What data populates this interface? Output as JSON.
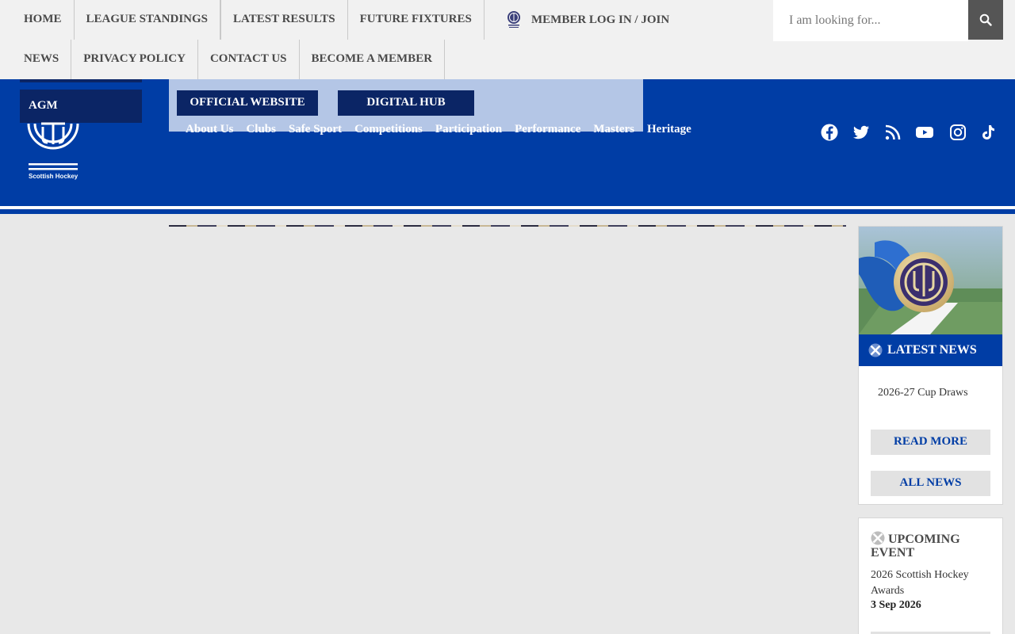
{
  "topnav": {
    "row1": [
      "HOME",
      "LEAGUE STANDINGS",
      "LATEST RESULTS",
      "FUTURE FIXTURES"
    ],
    "row2": [
      "NEWS",
      "PRIVACY POLICY",
      "CONTACT US",
      "BECOME A MEMBER"
    ],
    "member_label": "MEMBER LOG IN / JOIN",
    "search_placeholder": "I am looking for..."
  },
  "header": {
    "agm_label": "AGM",
    "official_website": "OFFICIAL WEBSITE",
    "digital_hub": "DIGITAL HUB",
    "subnav": [
      "About Us",
      "Clubs",
      "Safe Sport",
      "Competitions",
      "Participation",
      "Performance",
      "Masters",
      "Heritage"
    ],
    "logo_text": "Scottish Hockey",
    "social_icons": [
      "facebook-icon",
      "twitter-icon",
      "rss-icon",
      "youtube-icon",
      "instagram-icon",
      "tiktok-icon"
    ]
  },
  "news": {
    "heading": "LATEST NEWS",
    "title": "2026-27 Cup Draws",
    "read_more": "READ MORE",
    "all_news": "ALL NEWS"
  },
  "event": {
    "heading": "UPCOMING EVENT",
    "name": "2026 Scottish Hockey Awards",
    "date": "3 Sep 2026"
  },
  "colors": {
    "brand_blue": "#003da5",
    "navy": "#0b2565",
    "panel_blue": "#b4c6e6",
    "nav_bg": "#f1f1f1",
    "page_bg": "#e8e8e8"
  }
}
